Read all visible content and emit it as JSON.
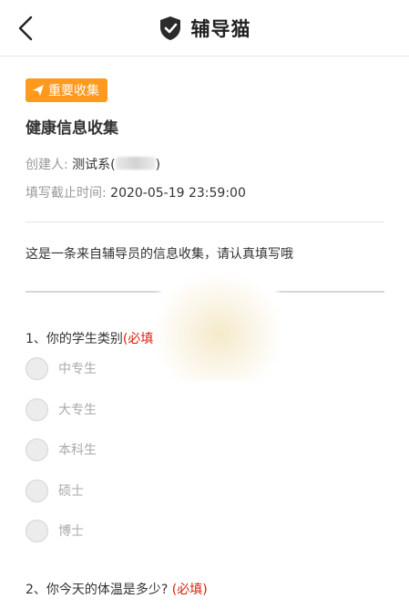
{
  "app": {
    "title": "辅导猫"
  },
  "badge": {
    "label": "重要收集"
  },
  "form": {
    "title": "健康信息收集",
    "creator_label": "创建人:",
    "creator_value": "测试系(",
    "creator_suffix": ")",
    "deadline_label": "填写截止时间:",
    "deadline_value": "2020-05-19 23:59:00",
    "description": "这是一条来自辅导员的信息收集，请认真填写哦"
  },
  "questions": [
    {
      "text": "1、你的学生类别",
      "required_label": "(必填",
      "options": [
        "中专生",
        "大专生",
        "本科生",
        "硕士",
        "博士"
      ]
    },
    {
      "text": "2、你今天的体温是多少? ",
      "required_label": "(必填)"
    }
  ],
  "colors": {
    "badge": "#ff9a1f",
    "required": "#d81e06",
    "label_gray": "#999999"
  },
  "icons": {
    "back": "chevron-left-icon",
    "logo": "shield-check-icon",
    "badge": "send-icon"
  }
}
